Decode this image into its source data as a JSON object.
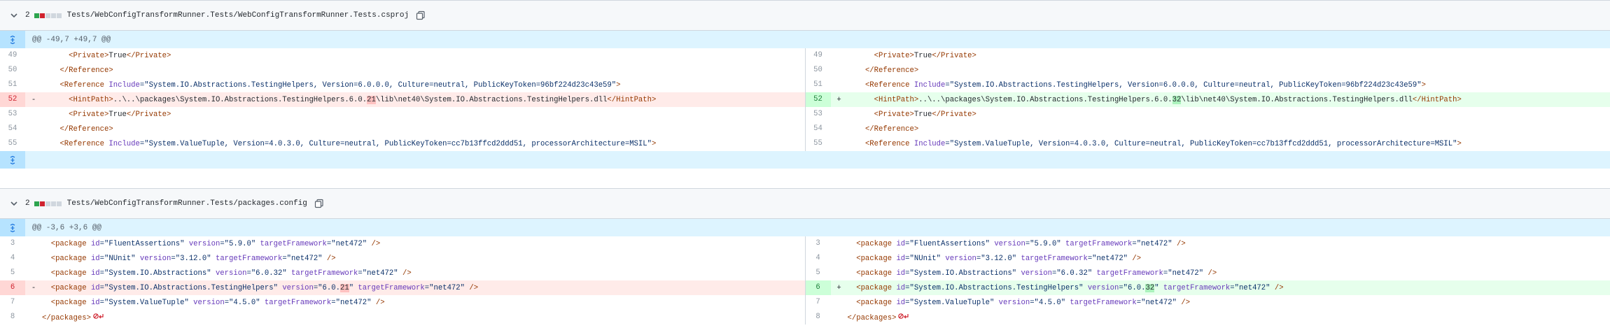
{
  "files": [
    {
      "count": "2",
      "name": "Tests/WebConfigTransformRunner.Tests/WebConfigTransformRunner.Tests.csproj",
      "hunk": "@@ -49,7 +49,7 @@",
      "left": [
        {
          "n": "49",
          "t": "ctx",
          "segs": [
            [
              "      ",
              ""
            ],
            [
              "<Private>",
              "tag"
            ],
            [
              "True",
              ""
            ],
            [
              "</Private>",
              "tag"
            ]
          ]
        },
        {
          "n": "50",
          "t": "ctx",
          "segs": [
            [
              "    ",
              ""
            ],
            [
              "</Reference>",
              "tag"
            ]
          ]
        },
        {
          "n": "51",
          "t": "ctx",
          "segs": [
            [
              "    ",
              ""
            ],
            [
              "<Reference ",
              "tag"
            ],
            [
              "Include",
              "attr"
            ],
            [
              "=\"System.IO.Abstractions.TestingHelpers, Version=6.0.0.0, Culture=neutral, PublicKeyToken=96bf224d23c43e59\"",
              "val"
            ],
            [
              ">",
              "tag"
            ]
          ]
        },
        {
          "n": "52",
          "t": "del",
          "m": "-",
          "segs": [
            [
              "      ",
              ""
            ],
            [
              "<HintPath>",
              "tag"
            ],
            [
              "..\\..\\packages\\System.IO.Abstractions.TestingHelpers.6.0.",
              ""
            ],
            [
              "21",
              "hl-del"
            ],
            [
              "\\lib\\net40\\System.IO.Abstractions.TestingHelpers.dll",
              ""
            ],
            [
              "</HintPath>",
              "tag"
            ]
          ]
        },
        {
          "n": "53",
          "t": "ctx",
          "segs": [
            [
              "      ",
              ""
            ],
            [
              "<Private>",
              "tag"
            ],
            [
              "True",
              ""
            ],
            [
              "</Private>",
              "tag"
            ]
          ]
        },
        {
          "n": "54",
          "t": "ctx",
          "segs": [
            [
              "    ",
              ""
            ],
            [
              "</Reference>",
              "tag"
            ]
          ]
        },
        {
          "n": "55",
          "t": "ctx",
          "segs": [
            [
              "    ",
              ""
            ],
            [
              "<Reference ",
              "tag"
            ],
            [
              "Include",
              "attr"
            ],
            [
              "=\"System.ValueTuple, Version=4.0.3.0, Culture=neutral, PublicKeyToken=cc7b13ffcd2ddd51, processorArchitecture=MSIL\"",
              "val"
            ],
            [
              ">",
              "tag"
            ]
          ]
        }
      ],
      "right": [
        {
          "n": "49",
          "t": "ctx",
          "segs": [
            [
              "      ",
              ""
            ],
            [
              "<Private>",
              "tag"
            ],
            [
              "True",
              ""
            ],
            [
              "</Private>",
              "tag"
            ]
          ]
        },
        {
          "n": "50",
          "t": "ctx",
          "segs": [
            [
              "    ",
              ""
            ],
            [
              "</Reference>",
              "tag"
            ]
          ]
        },
        {
          "n": "51",
          "t": "ctx",
          "segs": [
            [
              "    ",
              ""
            ],
            [
              "<Reference ",
              "tag"
            ],
            [
              "Include",
              "attr"
            ],
            [
              "=\"System.IO.Abstractions.TestingHelpers, Version=6.0.0.0, Culture=neutral, PublicKeyToken=96bf224d23c43e59\"",
              "val"
            ],
            [
              ">",
              "tag"
            ]
          ]
        },
        {
          "n": "52",
          "t": "add",
          "m": "+",
          "segs": [
            [
              "      ",
              ""
            ],
            [
              "<HintPath>",
              "tag"
            ],
            [
              "..\\..\\packages\\System.IO.Abstractions.TestingHelpers.6.0.",
              ""
            ],
            [
              "32",
              "hl-add"
            ],
            [
              "\\lib\\net40\\System.IO.Abstractions.TestingHelpers.dll",
              ""
            ],
            [
              "</HintPath>",
              "tag"
            ]
          ]
        },
        {
          "n": "53",
          "t": "ctx",
          "segs": [
            [
              "      ",
              ""
            ],
            [
              "<Private>",
              "tag"
            ],
            [
              "True",
              ""
            ],
            [
              "</Private>",
              "tag"
            ]
          ]
        },
        {
          "n": "54",
          "t": "ctx",
          "segs": [
            [
              "    ",
              ""
            ],
            [
              "</Reference>",
              "tag"
            ]
          ]
        },
        {
          "n": "55",
          "t": "ctx",
          "segs": [
            [
              "    ",
              ""
            ],
            [
              "<Reference ",
              "tag"
            ],
            [
              "Include",
              "attr"
            ],
            [
              "=\"System.ValueTuple, Version=4.0.3.0, Culture=neutral, PublicKeyToken=cc7b13ffcd2ddd51, processorArchitecture=MSIL\"",
              "val"
            ],
            [
              ">",
              "tag"
            ]
          ]
        }
      ],
      "has_foot": true
    },
    {
      "count": "2",
      "name": "Tests/WebConfigTransformRunner.Tests/packages.config",
      "hunk": "@@ -3,6 +3,6 @@",
      "left": [
        {
          "n": "3",
          "t": "ctx",
          "segs": [
            [
              "  ",
              ""
            ],
            [
              "<package ",
              "tag"
            ],
            [
              "id",
              "attr"
            ],
            [
              "=\"FluentAssertions\" ",
              "val"
            ],
            [
              "version",
              "attr"
            ],
            [
              "=\"5.9.0\" ",
              "val"
            ],
            [
              "targetFramework",
              "attr"
            ],
            [
              "=\"net472\"",
              "val"
            ],
            [
              " />",
              "tag"
            ]
          ]
        },
        {
          "n": "4",
          "t": "ctx",
          "segs": [
            [
              "  ",
              ""
            ],
            [
              "<package ",
              "tag"
            ],
            [
              "id",
              "attr"
            ],
            [
              "=\"NUnit\" ",
              "val"
            ],
            [
              "version",
              "attr"
            ],
            [
              "=\"3.12.0\" ",
              "val"
            ],
            [
              "targetFramework",
              "attr"
            ],
            [
              "=\"net472\"",
              "val"
            ],
            [
              " />",
              "tag"
            ]
          ]
        },
        {
          "n": "5",
          "t": "ctx",
          "segs": [
            [
              "  ",
              ""
            ],
            [
              "<package ",
              "tag"
            ],
            [
              "id",
              "attr"
            ],
            [
              "=\"System.IO.Abstractions\" ",
              "val"
            ],
            [
              "version",
              "attr"
            ],
            [
              "=\"6.0.32\" ",
              "val"
            ],
            [
              "targetFramework",
              "attr"
            ],
            [
              "=\"net472\"",
              "val"
            ],
            [
              " />",
              "tag"
            ]
          ]
        },
        {
          "n": "6",
          "t": "del",
          "m": "-",
          "segs": [
            [
              "  ",
              ""
            ],
            [
              "<package ",
              "tag"
            ],
            [
              "id",
              "attr"
            ],
            [
              "=\"System.IO.Abstractions.TestingHelpers\" ",
              "val"
            ],
            [
              "version",
              "attr"
            ],
            [
              "=\"6.0.",
              "val"
            ],
            [
              "21",
              "hl-del"
            ],
            [
              "\" ",
              "val"
            ],
            [
              "targetFramework",
              "attr"
            ],
            [
              "=\"net472\"",
              "val"
            ],
            [
              " />",
              "tag"
            ]
          ]
        },
        {
          "n": "7",
          "t": "ctx",
          "segs": [
            [
              "  ",
              ""
            ],
            [
              "<package ",
              "tag"
            ],
            [
              "id",
              "attr"
            ],
            [
              "=\"System.ValueTuple\" ",
              "val"
            ],
            [
              "version",
              "attr"
            ],
            [
              "=\"4.5.0\" ",
              "val"
            ],
            [
              "targetFramework",
              "attr"
            ],
            [
              "=\"net472\"",
              "val"
            ],
            [
              " />",
              "tag"
            ]
          ]
        },
        {
          "n": "8",
          "t": "ctx",
          "eol": true,
          "segs": [
            [
              "</packages>",
              "tag"
            ]
          ]
        }
      ],
      "right": [
        {
          "n": "3",
          "t": "ctx",
          "segs": [
            [
              "  ",
              ""
            ],
            [
              "<package ",
              "tag"
            ],
            [
              "id",
              "attr"
            ],
            [
              "=\"FluentAssertions\" ",
              "val"
            ],
            [
              "version",
              "attr"
            ],
            [
              "=\"5.9.0\" ",
              "val"
            ],
            [
              "targetFramework",
              "attr"
            ],
            [
              "=\"net472\"",
              "val"
            ],
            [
              " />",
              "tag"
            ]
          ]
        },
        {
          "n": "4",
          "t": "ctx",
          "segs": [
            [
              "  ",
              ""
            ],
            [
              "<package ",
              "tag"
            ],
            [
              "id",
              "attr"
            ],
            [
              "=\"NUnit\" ",
              "val"
            ],
            [
              "version",
              "attr"
            ],
            [
              "=\"3.12.0\" ",
              "val"
            ],
            [
              "targetFramework",
              "attr"
            ],
            [
              "=\"net472\"",
              "val"
            ],
            [
              " />",
              "tag"
            ]
          ]
        },
        {
          "n": "5",
          "t": "ctx",
          "segs": [
            [
              "  ",
              ""
            ],
            [
              "<package ",
              "tag"
            ],
            [
              "id",
              "attr"
            ],
            [
              "=\"System.IO.Abstractions\" ",
              "val"
            ],
            [
              "version",
              "attr"
            ],
            [
              "=\"6.0.32\" ",
              "val"
            ],
            [
              "targetFramework",
              "attr"
            ],
            [
              "=\"net472\"",
              "val"
            ],
            [
              " />",
              "tag"
            ]
          ]
        },
        {
          "n": "6",
          "t": "add",
          "m": "+",
          "segs": [
            [
              "  ",
              ""
            ],
            [
              "<package ",
              "tag"
            ],
            [
              "id",
              "attr"
            ],
            [
              "=\"System.IO.Abstractions.TestingHelpers\" ",
              "val"
            ],
            [
              "version",
              "attr"
            ],
            [
              "=\"6.0.",
              "val"
            ],
            [
              "32",
              "hl-add"
            ],
            [
              "\" ",
              "val"
            ],
            [
              "targetFramework",
              "attr"
            ],
            [
              "=\"net472\"",
              "val"
            ],
            [
              " />",
              "tag"
            ]
          ]
        },
        {
          "n": "7",
          "t": "ctx",
          "segs": [
            [
              "  ",
              ""
            ],
            [
              "<package ",
              "tag"
            ],
            [
              "id",
              "attr"
            ],
            [
              "=\"System.ValueTuple\" ",
              "val"
            ],
            [
              "version",
              "attr"
            ],
            [
              "=\"4.5.0\" ",
              "val"
            ],
            [
              "targetFramework",
              "attr"
            ],
            [
              "=\"net472\"",
              "val"
            ],
            [
              " />",
              "tag"
            ]
          ]
        },
        {
          "n": "8",
          "t": "ctx",
          "eol": true,
          "segs": [
            [
              "</packages>",
              "tag"
            ]
          ]
        }
      ],
      "has_foot": false
    }
  ],
  "colors": {
    "added": "#2da44e",
    "removed": "#cf222e",
    "neutral": "#d0d7de"
  },
  "icons": {
    "collapse": "chevron-down-icon",
    "copy": "copy-icon",
    "expand": "expand-icon",
    "no_newline": "no-newline-icon"
  }
}
